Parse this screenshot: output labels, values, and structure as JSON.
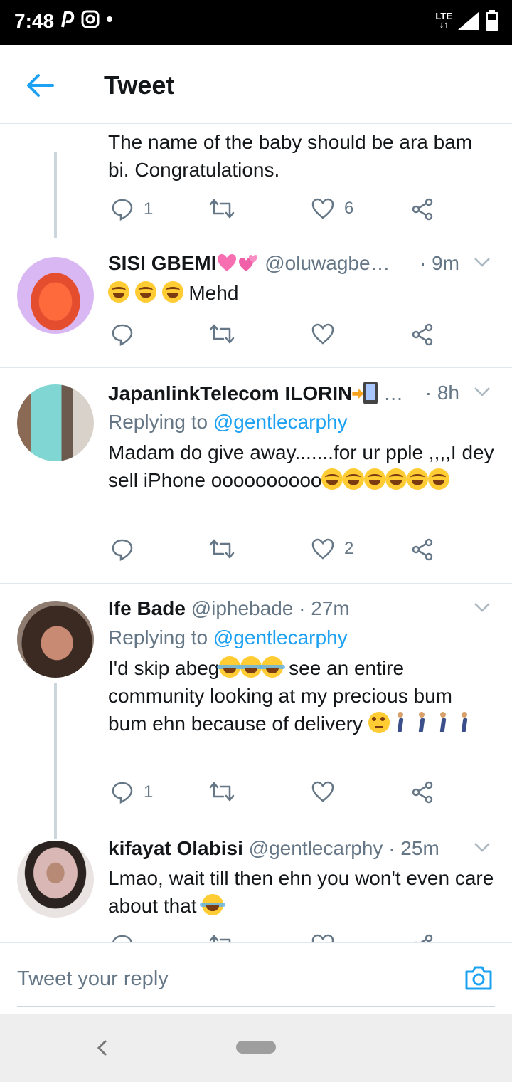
{
  "status_bar": {
    "time": "7:48",
    "network": "LTE"
  },
  "header": {
    "title": "Tweet"
  },
  "tweets": [
    {
      "text": "The name of the baby should be ara bam bi. Congratulations.",
      "reply_count": "1",
      "like_count": "6"
    },
    {
      "name": "SISI GBEMI",
      "handle": "@oluwagbe…",
      "time": "· 9m",
      "text": "Mehd",
      "reply_count": "",
      "like_count": ""
    },
    {
      "name": "JapanlinkTelecom ILORIN",
      "handle": "…",
      "time": "· 8h",
      "replying_label": "Replying to",
      "replying_to": "@gentlecarphy",
      "text_a": "Madam do give away.......for ur pple ,,,,I dey sell iPhone oooooooooo",
      "like_count": "2"
    },
    {
      "name": "Ife Bade",
      "handle": "@iphebade",
      "time": "· 27m",
      "replying_label": "Replying to",
      "replying_to": "@gentlecarphy",
      "text_a": "I'd skip abeg",
      "text_b": " see an entire community looking at my precious bum bum ehn because of delivery ",
      "reply_count": "1"
    },
    {
      "name": "kifayat Olabisi",
      "handle": "@gentlecarphy",
      "time": "· 25m",
      "text": "Lmao, wait till then ehn you won't even care about that "
    }
  ],
  "reply_bar": {
    "placeholder": "Tweet your reply"
  },
  "colors": {
    "accent": "#1da1f2",
    "secondary_text": "#657786",
    "divider": "#e1e8ed"
  }
}
